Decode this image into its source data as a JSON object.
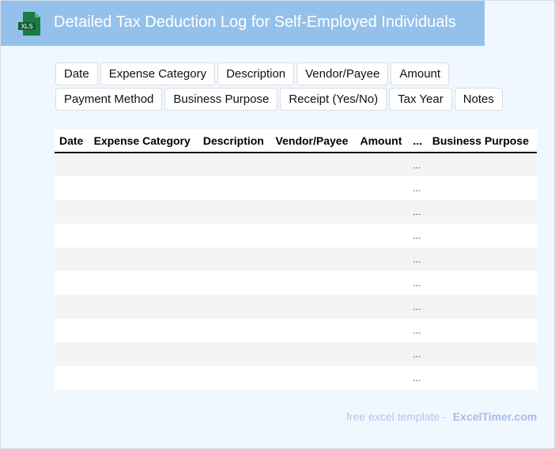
{
  "header": {
    "title": "Detailed Tax Deduction Log for Self-Employed Individuals",
    "logo_text": "XLS",
    "color": "#93c1ec"
  },
  "chips": [
    "Date",
    "Expense Category",
    "Description",
    "Vendor/Payee",
    "Amount",
    "Payment Method",
    "Business Purpose",
    "Receipt (Yes/No)",
    "Tax Year",
    "Notes"
  ],
  "table": {
    "columns": [
      "Date",
      "Expense Category",
      "Description",
      "Vendor/Payee",
      "Amount",
      "...",
      "Business Purpose"
    ],
    "row_count": 10,
    "ellipsis": "..."
  },
  "footer": {
    "text": "free excel template -",
    "brand": "ExcelTimer.com"
  }
}
